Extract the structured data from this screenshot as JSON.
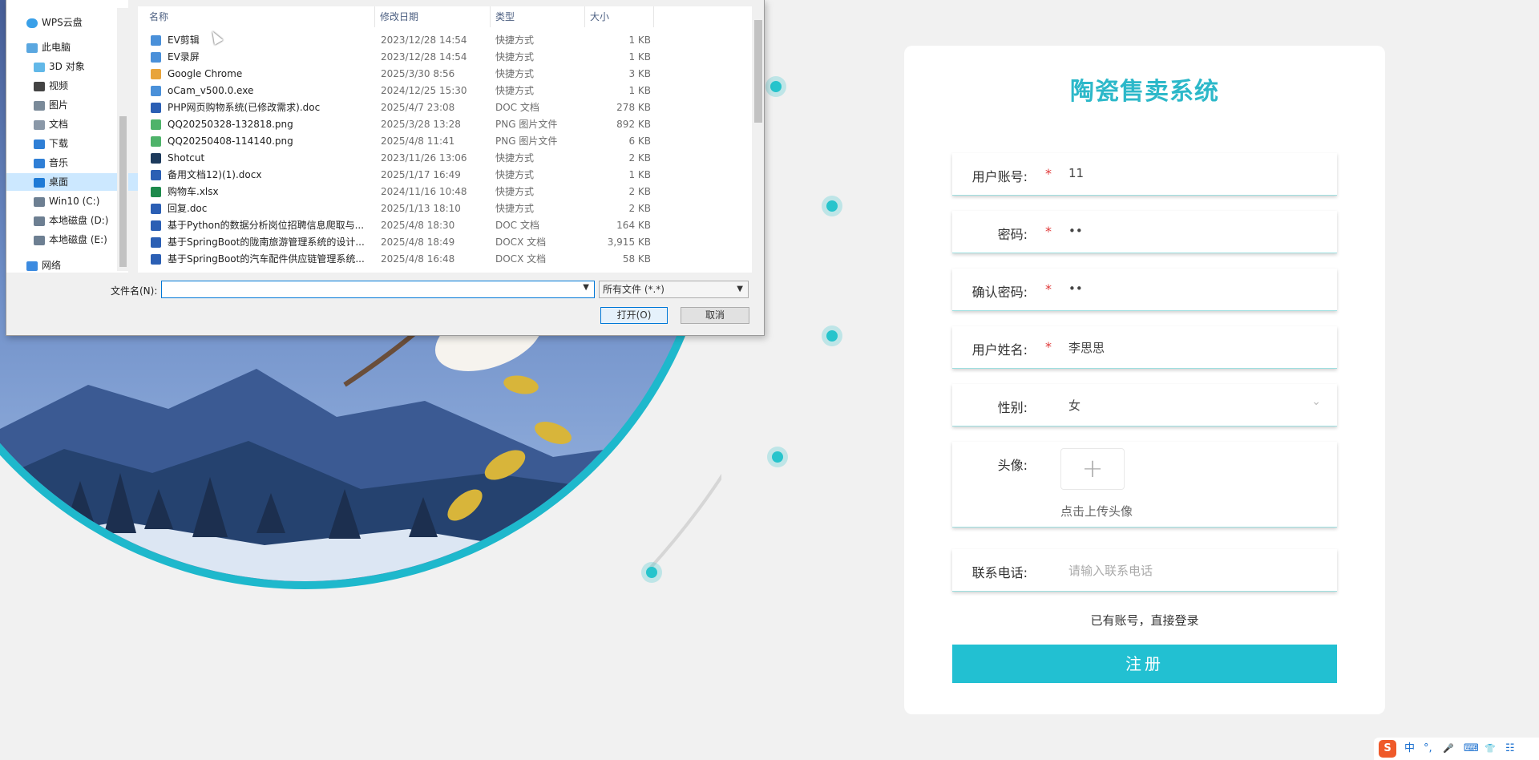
{
  "form": {
    "title": "陶瓷售卖系统",
    "fields": {
      "account": {
        "label": "用户账号:",
        "required": "*",
        "value": "11"
      },
      "password": {
        "label": "密码:",
        "required": "*",
        "value": "••"
      },
      "confirm_password": {
        "label": "确认密码:",
        "required": "*",
        "value": "••"
      },
      "name": {
        "label": "用户姓名:",
        "required": "*",
        "value": "李思思"
      },
      "gender": {
        "label": "性别:",
        "value": "女"
      },
      "avatar": {
        "label": "头像:",
        "upload_tip": "点击上传头像",
        "upload_icon": "+"
      },
      "phone": {
        "label": "联系电话:",
        "placeholder": "请输入联系电话"
      }
    },
    "login_link": "已有账号，直接登录",
    "submit_label": "注册"
  },
  "dialog": {
    "nav": [
      {
        "label": "WPS云盘",
        "icon": "cloud-icon"
      },
      {
        "label": "此电脑",
        "icon": "computer-icon"
      },
      {
        "label": "3D 对象",
        "icon": "cube-icon"
      },
      {
        "label": "视频",
        "icon": "video-icon"
      },
      {
        "label": "图片",
        "icon": "picture-icon"
      },
      {
        "label": "文档",
        "icon": "document-icon"
      },
      {
        "label": "下载",
        "icon": "download-icon"
      },
      {
        "label": "音乐",
        "icon": "music-icon"
      },
      {
        "label": "桌面",
        "icon": "desktop-icon"
      },
      {
        "label": "Win10 (C:)",
        "icon": "drive-icon"
      },
      {
        "label": "本地磁盘 (D:)",
        "icon": "drive-icon"
      },
      {
        "label": "本地磁盘 (E:)",
        "icon": "drive-icon"
      },
      {
        "label": "网络",
        "icon": "network-icon"
      }
    ],
    "columns": {
      "name": "名称",
      "date": "修改日期",
      "type": "类型",
      "size": "大小"
    },
    "files": [
      {
        "name": "EV剪辑",
        "date": "2023/12/28 14:54",
        "type": "快捷方式",
        "size": "1 KB",
        "icon": "shortcut-icon"
      },
      {
        "name": "EV录屏",
        "date": "2023/12/28 14:54",
        "type": "快捷方式",
        "size": "1 KB",
        "icon": "shortcut-icon"
      },
      {
        "name": "Google Chrome",
        "date": "2025/3/30 8:56",
        "type": "快捷方式",
        "size": "3 KB",
        "icon": "chrome-icon"
      },
      {
        "name": "oCam_v500.0.exe",
        "date": "2024/12/25 15:30",
        "type": "快捷方式",
        "size": "1 KB",
        "icon": "shortcut-icon"
      },
      {
        "name": "PHP网页购物系统(已修改需求).doc",
        "date": "2025/4/7 23:08",
        "type": "DOC 文档",
        "size": "278 KB",
        "icon": "word-icon"
      },
      {
        "name": "QQ20250328-132818.png",
        "date": "2025/3/28 13:28",
        "type": "PNG 图片文件",
        "size": "892 KB",
        "icon": "image-icon"
      },
      {
        "name": "QQ20250408-114140.png",
        "date": "2025/4/8 11:41",
        "type": "PNG 图片文件",
        "size": "6 KB",
        "icon": "image-icon"
      },
      {
        "name": "Shotcut",
        "date": "2023/11/26 13:06",
        "type": "快捷方式",
        "size": "2 KB",
        "icon": "shotcut-icon"
      },
      {
        "name": "备用文档12)(1).docx",
        "date": "2025/1/17 16:49",
        "type": "快捷方式",
        "size": "1 KB",
        "icon": "word-icon"
      },
      {
        "name": "购物车.xlsx",
        "date": "2024/11/16 10:48",
        "type": "快捷方式",
        "size": "2 KB",
        "icon": "excel-icon"
      },
      {
        "name": "回复.doc",
        "date": "2025/1/13 18:10",
        "type": "快捷方式",
        "size": "2 KB",
        "icon": "word-icon"
      },
      {
        "name": "基于Python的数据分析岗位招聘信息爬取与...",
        "date": "2025/4/8 18:30",
        "type": "DOC 文档",
        "size": "164 KB",
        "icon": "word-icon"
      },
      {
        "name": "基于SpringBoot的陇南旅游管理系统的设计...",
        "date": "2025/4/8 18:49",
        "type": "DOCX 文档",
        "size": "3,915 KB",
        "icon": "word-icon"
      },
      {
        "name": "基于SpringBoot的汽车配件供应链管理系统...",
        "date": "2025/4/8 16:48",
        "type": "DOCX 文档",
        "size": "58 KB",
        "icon": "word-icon"
      }
    ],
    "filename_label": "文件名(N):",
    "filename_value": "",
    "filetype_value": "所有文件 (*.*)",
    "open_label": "打开(O)",
    "cancel_label": "取消"
  },
  "taskbar": {
    "ime_logo": "S",
    "ime_lang": "中",
    "ime_items": [
      "°,",
      "🎤",
      "⌨",
      "👕",
      "☷"
    ]
  },
  "colors": {
    "accent": "#22c0d2",
    "title": "#2cb8c9",
    "required": "#e03a3a",
    "selection": "#cce8ff"
  }
}
